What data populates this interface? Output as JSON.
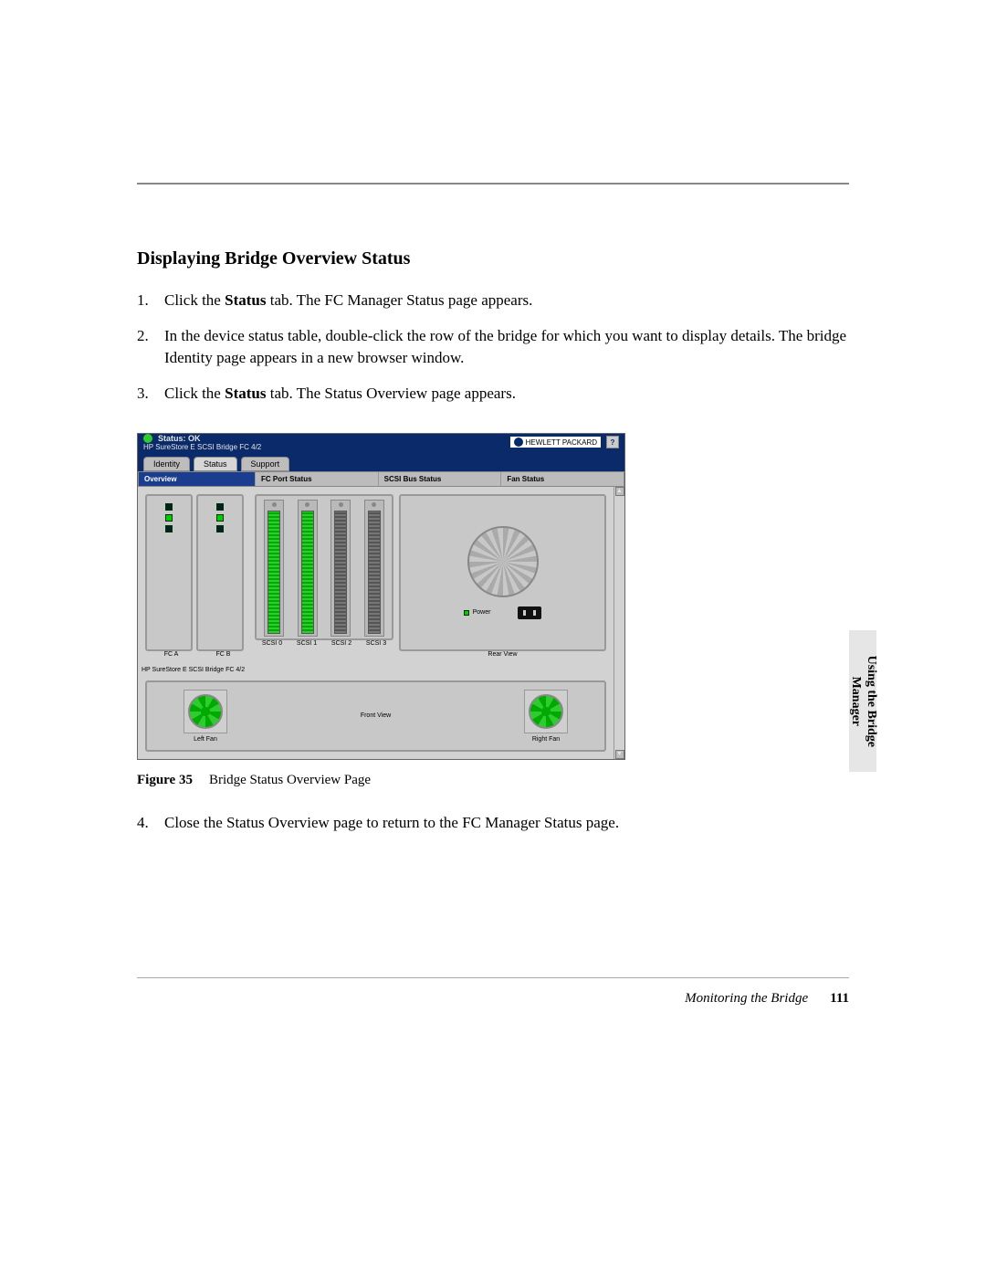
{
  "heading": "Displaying Bridge Overview Status",
  "steps": {
    "s1a": "Click the ",
    "s1b": "Status",
    "s1c": " tab. The FC Manager Status page appears.",
    "s2": "In the device status table, double-click the row of the bridge for which you want to display details. The bridge Identity page appears in a new browser window.",
    "s3a": "Click the ",
    "s3b": "Status",
    "s3c": " tab. The Status Overview page appears.",
    "s4": "Close the Status Overview page to return to the FC Manager Status page."
  },
  "screenshot": {
    "status_label": "Status: OK",
    "product": "HP SureStore E SCSI Bridge FC 4/2",
    "logo_text": "HEWLETT PACKARD",
    "help": "?",
    "tabs": {
      "identity": "Identity",
      "status": "Status",
      "support": "Support"
    },
    "cols": {
      "overview": "Overview",
      "fc": "FC Port Status",
      "scsi": "SCSI Bus Status",
      "fan": "Fan Status"
    },
    "fc_labels": {
      "a": "FC A",
      "b": "FC B"
    },
    "scsi_labels": {
      "s0": "SCSI 0",
      "s1": "SCSI 1",
      "s2": "SCSI 2",
      "s3": "SCSI 3"
    },
    "power": "Power",
    "rear": "Rear View",
    "device_caption": "HP SureStore E SCSI Bridge FC 4/2",
    "left_fan": "Left Fan",
    "right_fan": "Right Fan",
    "front": "Front View",
    "scroll_up": "▲",
    "scroll_dn": "▼"
  },
  "figure": {
    "label": "Figure 35",
    "caption": "Bridge Status Overview Page"
  },
  "sidetab": {
    "l1": "Using the Bridge",
    "l2": "Manager"
  },
  "footer": {
    "section": "Monitoring the Bridge",
    "page": "111"
  }
}
